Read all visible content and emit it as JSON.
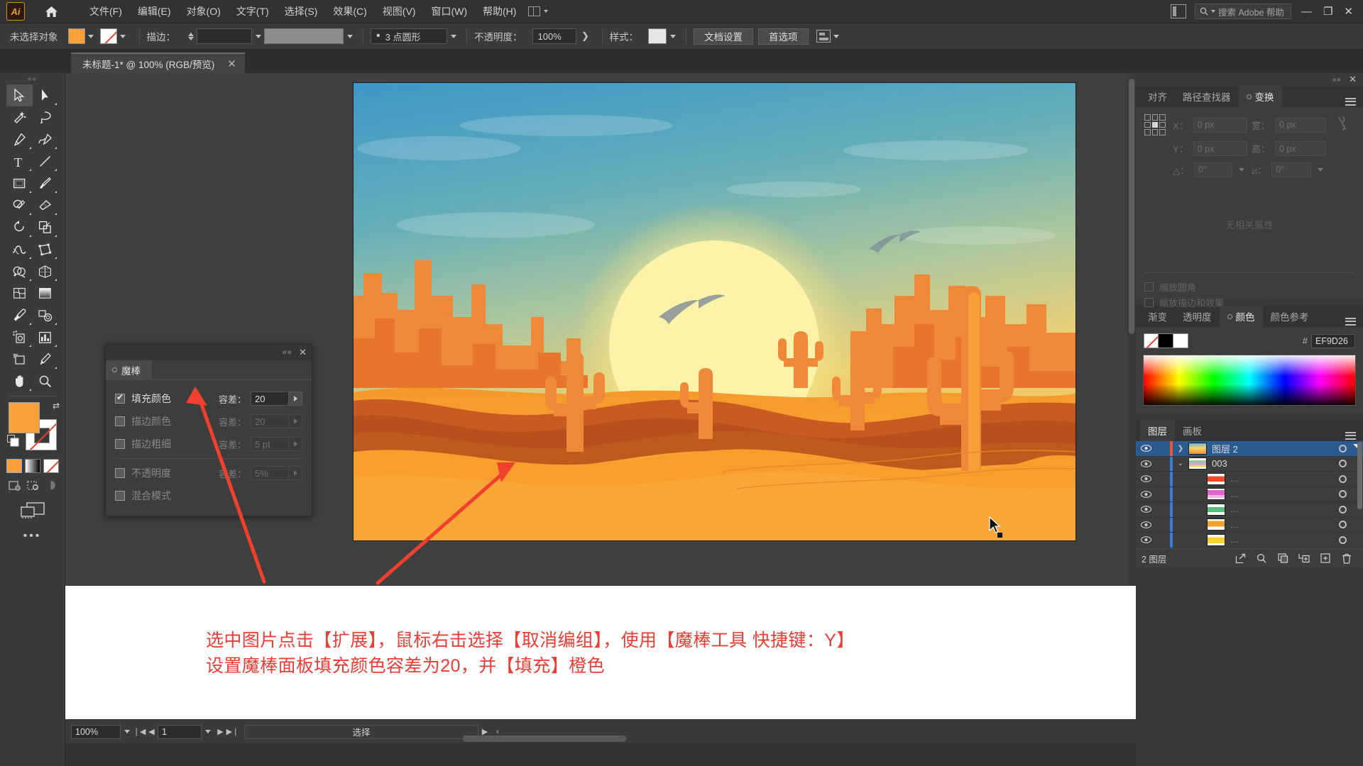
{
  "app": {
    "logo": "Ai",
    "home_icon": "home-icon",
    "search_placeholder": "搜索 Adobe 帮助",
    "menus": [
      "文件(F)",
      "编辑(E)",
      "对象(O)",
      "文字(T)",
      "选择(S)",
      "效果(C)",
      "视图(V)",
      "窗口(W)",
      "帮助(H)"
    ],
    "window_controls": [
      "—",
      "❐",
      "✕"
    ]
  },
  "control_bar": {
    "selection_label": "未选择对象",
    "stroke_label": "描边：",
    "stroke_weight": "",
    "profile": "3 点圆形",
    "opacity_label": "不透明度：",
    "opacity_value": "100%",
    "style_label": "样式：",
    "doc_setup": "文档设置",
    "preferences": "首选项"
  },
  "document_tab": {
    "title": "未标题-1* @ 100% (RGB/预览)",
    "close": "✕"
  },
  "toolbar": {
    "tools": [
      "selection-tool",
      "direct-selection-tool",
      "magic-wand-tool",
      "lasso-tool",
      "pen-tool",
      "curvature-tool",
      "type-tool",
      "line-segment-tool",
      "rectangle-tool",
      "paintbrush-tool",
      "shaper-tool",
      "eraser-tool",
      "rotate-tool",
      "scale-tool",
      "width-tool",
      "free-transform-tool",
      "shape-builder-tool",
      "perspective-grid-tool",
      "mesh-tool",
      "gradient-tool",
      "eyedropper-tool",
      "blend-tool",
      "symbol-sprayer-tool",
      "column-graph-tool",
      "artboard-tool",
      "slice-tool",
      "hand-tool",
      "zoom-tool"
    ],
    "fill_color": "#F9A13A",
    "stroke_color": "none",
    "more_label": "•••"
  },
  "magic_wand_panel": {
    "title": "魔棒",
    "close": "✕",
    "grip": "««",
    "rows": [
      {
        "label": "填充颜色",
        "checked": true,
        "tol_label": "容差：",
        "tol_value": "20",
        "enabled": true
      },
      {
        "label": "描边颜色",
        "checked": false,
        "tol_label": "容差：",
        "tol_value": "20",
        "enabled": false
      },
      {
        "label": "描边粗细",
        "checked": false,
        "tol_label": "容差：",
        "tol_value": "5 pt",
        "enabled": false
      },
      {
        "label": "不透明度",
        "checked": false,
        "tol_label": "容差：",
        "tol_value": "5%",
        "enabled": false
      },
      {
        "label": "混合模式",
        "checked": false,
        "tol_label": "",
        "tol_value": "",
        "enabled": false
      }
    ]
  },
  "transform_panel": {
    "tabs": [
      "对齐",
      "路径查找器",
      "变换"
    ],
    "active_tab": "变换",
    "fields": {
      "x_label": "X：",
      "x_value": "0 px",
      "y_label": "Y：",
      "y_value": "0 px",
      "w_label": "宽：",
      "w_value": "0 px",
      "h_label": "高：",
      "h_value": "0 px",
      "angle_label": "△：",
      "angle_value": "0°",
      "shear_label": "⧄：",
      "shear_value": "0°"
    },
    "empty_text": "无相关属性",
    "checkboxes": [
      "缩放圆角",
      "缩放描边和效果"
    ]
  },
  "color_panel": {
    "tabs": [
      "渐变",
      "透明度",
      "颜色",
      "颜色参考"
    ],
    "active_tab": "颜色",
    "hash": "#",
    "hex_value": "EF9D26"
  },
  "layers_panel": {
    "tabs": [
      "图层",
      "画板"
    ],
    "active_tab": "图层",
    "rows": [
      {
        "name": "图层 2",
        "selected": true,
        "depth": 0,
        "expanded": false,
        "color": "#e05a3a",
        "thumb": "sunset",
        "has_twist": true
      },
      {
        "name": "003",
        "selected": false,
        "depth": 1,
        "expanded": true,
        "color": "#3a7ad0",
        "thumb": "stripes",
        "has_twist": true
      },
      {
        "name": "…",
        "selected": false,
        "depth": 2,
        "expanded": false,
        "color": "#3a7ad0",
        "thumb": "red",
        "has_twist": false
      },
      {
        "name": "…",
        "selected": false,
        "depth": 2,
        "expanded": false,
        "color": "#3a7ad0",
        "thumb": "magenta",
        "has_twist": false
      },
      {
        "name": "…",
        "selected": false,
        "depth": 2,
        "expanded": false,
        "color": "#3a7ad0",
        "thumb": "green",
        "has_twist": false
      },
      {
        "name": "…",
        "selected": false,
        "depth": 2,
        "expanded": false,
        "color": "#3a7ad0",
        "thumb": "orange",
        "has_twist": false
      },
      {
        "name": "…",
        "selected": false,
        "depth": 2,
        "expanded": false,
        "color": "#3a7ad0",
        "thumb": "yellow",
        "has_twist": false
      }
    ],
    "footer_count": "2 图层",
    "footer_buttons": [
      "locate-object-icon",
      "search-icon",
      "make-clipping-mask-icon",
      "create-sublayer-icon",
      "new-layer-icon",
      "delete-layer-icon"
    ]
  },
  "caption": {
    "line1": "选中图片点击【扩展】，鼠标右击选择【取消编组】，使用【魔棒工具 快捷键：Y】",
    "line2": "设置魔棒面板填充颜色容差为20，并【填充】橙色"
  },
  "status_bar": {
    "zoom": "100%",
    "page": "1",
    "status_text": "选择"
  },
  "artwork": {
    "description": "desert-sunset-illustration",
    "sun_color": "#FDF3A8",
    "sky_top": "#3F9BC8",
    "sand_color": "#F79E2C"
  }
}
